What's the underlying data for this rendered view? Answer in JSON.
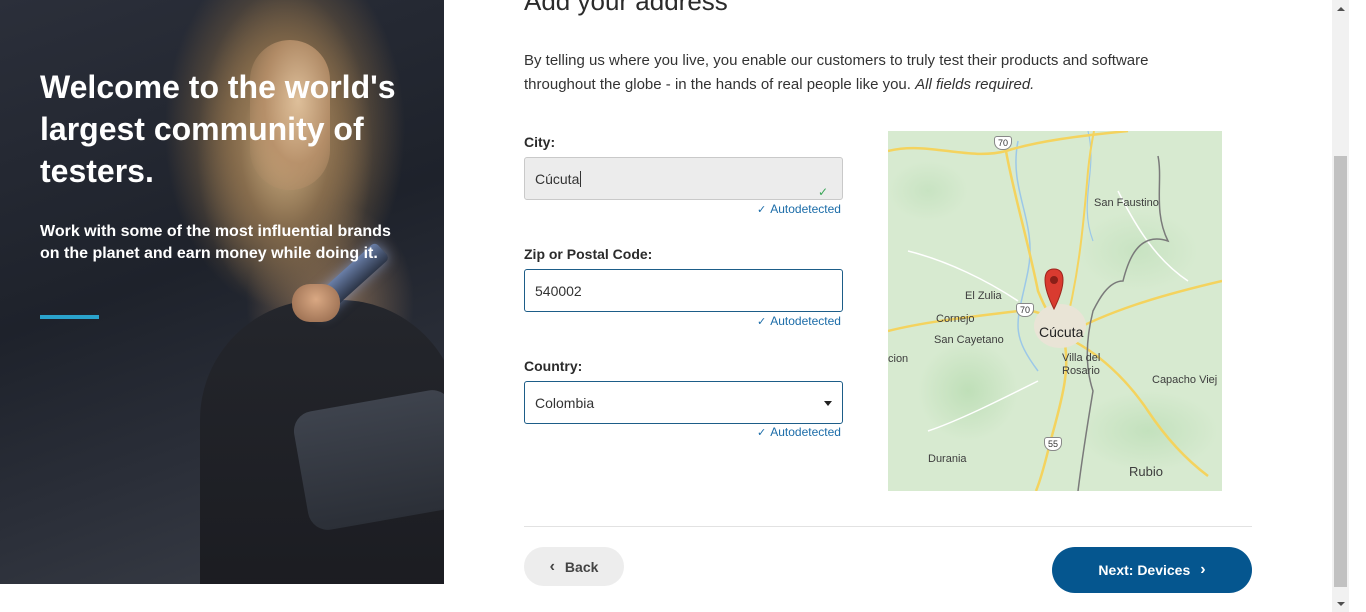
{
  "hero": {
    "title": "Welcome to the world's largest community of testers.",
    "subtitle": "Work with some of the most influential brands on the planet and earn money while doing it.",
    "accent_color": "#2aa3cc"
  },
  "main": {
    "heading": "Add your address",
    "intro": "By telling us where you live, you enable our customers to truly test their products and software throughout the globe - in the hands of real people like you.",
    "intro_emphasis": "All fields required."
  },
  "form": {
    "city": {
      "label": "City:",
      "value": "Cúcuta",
      "status": "Autodetected"
    },
    "zip": {
      "label": "Zip or Postal Code:",
      "value": "540002",
      "status": "Autodetected"
    },
    "country": {
      "label": "Country:",
      "value": "Colombia",
      "status": "Autodetected"
    }
  },
  "map": {
    "labels": {
      "city": "Cúcuta",
      "san_faustino": "San Faustino",
      "el_zulia": "El Zulia",
      "cornejo": "Cornejo",
      "san_cayetano": "San Cayetano",
      "villa_del_rosario": "Villa del Rosario",
      "capacho_viejo": "Capacho Viej",
      "durania": "Durania",
      "rubio": "Rubio",
      "cion": "cion"
    },
    "route_shields": [
      "70",
      "70",
      "55"
    ],
    "marker_color": "#d93b30"
  },
  "footer": {
    "back_label": "Back",
    "next_label": "Next: Devices",
    "next_color": "#05568f"
  }
}
